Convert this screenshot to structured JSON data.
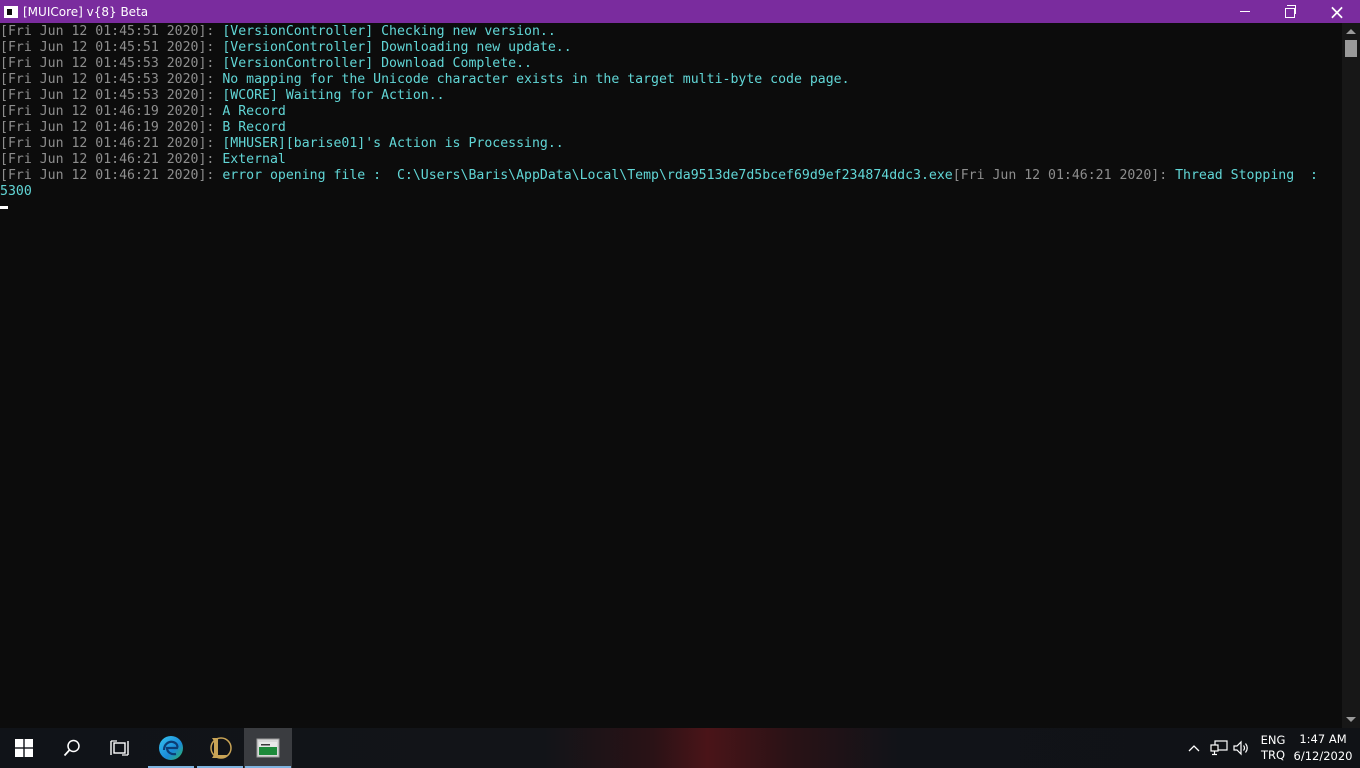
{
  "window": {
    "title": "[MUICore] v{8} Beta",
    "title_bar_color": "#7a2c9e",
    "controls": {
      "minimize": "minimize-icon",
      "restore": "restore-icon",
      "close": "×"
    }
  },
  "console": {
    "background": "#0c0c0c",
    "timestamp_color": "#8e8e8e",
    "message_color": "#61d6d6",
    "lines": [
      {
        "ts": "[Fri Jun 12 01:45:51 2020]: ",
        "msg": "[VersionController] Checking new version.."
      },
      {
        "ts": "[Fri Jun 12 01:45:51 2020]: ",
        "msg": "[VersionController] Downloading new update.."
      },
      {
        "ts": "[Fri Jun 12 01:45:53 2020]: ",
        "msg": "[VersionController] Download Complete.."
      },
      {
        "ts": "[Fri Jun 12 01:45:53 2020]: ",
        "msg": "No mapping for the Unicode character exists in the target multi-byte code page."
      },
      {
        "ts": "[Fri Jun 12 01:45:53 2020]: ",
        "msg": "[WCORE] Waiting for Action.."
      },
      {
        "ts": "[Fri Jun 12 01:46:19 2020]: ",
        "msg": "A Record"
      },
      {
        "ts": "[Fri Jun 12 01:46:19 2020]: ",
        "msg": "B Record"
      },
      {
        "ts": "[Fri Jun 12 01:46:21 2020]: ",
        "msg": "[MHUSER][barise01]'s Action is Processing.."
      },
      {
        "ts": "[Fri Jun 12 01:46:21 2020]: ",
        "msg": "External"
      },
      {
        "ts": "[Fri Jun 12 01:46:21 2020]: ",
        "msg": "error opening file :  C:\\Users\\Baris\\AppData\\Local\\Temp\\rda9513de7d5bcef69d9ef234874ddc3.exe",
        "ts2": "[Fri Jun 12 01:46:21 2020]: ",
        "msg2": "Thread Stopping  :"
      }
    ],
    "wrapped_line": "5300"
  },
  "taskbar": {
    "start": "windows-start-icon",
    "search": "search-icon",
    "task_view": "task-view-icon",
    "apps": [
      "edge-browser-icon",
      "league-of-legends-icon",
      "console-app-icon"
    ],
    "tray": {
      "show_hidden": "chevron-up-icon",
      "network": "network-icon",
      "volume": "volume-icon",
      "language_top": "ENG",
      "language_bottom": "TRQ",
      "time": "1:47 AM",
      "date": "6/12/2020"
    }
  }
}
